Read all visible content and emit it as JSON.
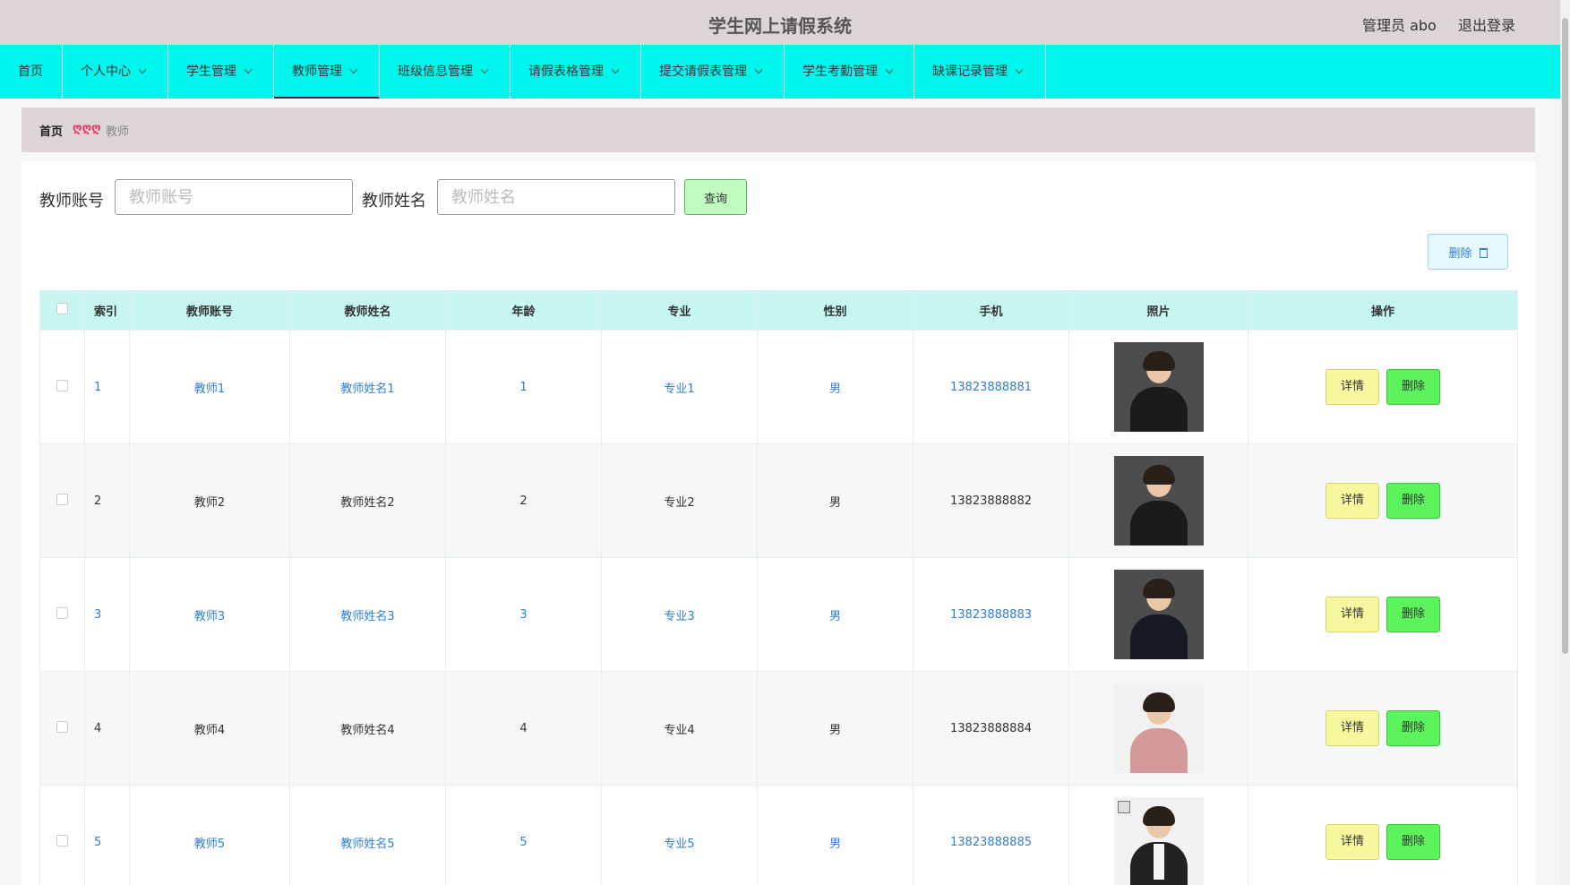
{
  "header": {
    "title": "学生网上请假系统",
    "admin": "管理员 abo",
    "logout": "退出登录"
  },
  "nav": {
    "items": [
      {
        "label": "首页"
      },
      {
        "label": "个人中心"
      },
      {
        "label": "学生管理"
      },
      {
        "label": "教师管理"
      },
      {
        "label": "班级信息管理"
      },
      {
        "label": "请假表格管理"
      },
      {
        "label": "提交请假表管理"
      },
      {
        "label": "学生考勤管理"
      },
      {
        "label": "缺课记录管理"
      }
    ],
    "active": "教师管理"
  },
  "breadcrumb": {
    "home": "首页",
    "separator": "ღღღ",
    "current": "教师"
  },
  "search": {
    "account_label": "教师账号",
    "account_placeholder": "教师账号",
    "name_label": "教师姓名",
    "name_placeholder": "教师姓名",
    "query_label": "查询"
  },
  "toolbar": {
    "delete_label": "删除"
  },
  "table": {
    "headers": [
      "索引",
      "教师账号",
      "教师姓名",
      "年龄",
      "专业",
      "性别",
      "手机",
      "照片",
      "操作"
    ],
    "rows": [
      {
        "index": "1",
        "account": "教师1",
        "name": "教师姓名1",
        "age": "1",
        "major": "专业1",
        "gender": "男",
        "phone": "13823888881"
      },
      {
        "index": "2",
        "account": "教师2",
        "name": "教师姓名2",
        "age": "2",
        "major": "专业2",
        "gender": "男",
        "phone": "13823888882"
      },
      {
        "index": "3",
        "account": "教师3",
        "name": "教师姓名3",
        "age": "3",
        "major": "专业3",
        "gender": "男",
        "phone": "13823888883"
      },
      {
        "index": "4",
        "account": "教师4",
        "name": "教师姓名4",
        "age": "4",
        "major": "专业4",
        "gender": "男",
        "phone": "13823888884"
      },
      {
        "index": "5",
        "account": "教师5",
        "name": "教师姓名5",
        "age": "5",
        "major": "专业5",
        "gender": "男",
        "phone": "13823888885"
      }
    ],
    "detail_label": "详情",
    "delete_label": "删除"
  },
  "colors": {
    "nav_bg": "#00f5ec",
    "header_bg": "#ddd5d5",
    "table_header_bg": "#c6f6ef",
    "link_blue": "#2f7fd0",
    "detail_btn": "#f6f79f",
    "delete_btn": "#5df35d"
  }
}
